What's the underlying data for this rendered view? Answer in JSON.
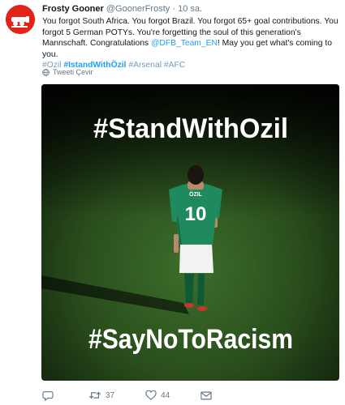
{
  "tweet": {
    "author_name": "Frosty Gooner",
    "author_handle": "@GoonerFrosty",
    "separator": "·",
    "time": "10 sa.",
    "text_part1": "You forgot South Africa. You forgot Brazil. You forgot 65+ goal contributions. You forgot 5 German POTYs. You're forgetting the soul of this generation's Mannschaft. Congratulations ",
    "mention": "@DFB_Team_EN",
    "text_part2": "! May you get what's coming to you.",
    "hashtags": [
      "#Ozil",
      "#IstandWithÖzil",
      "#Arsenal",
      "#AFC"
    ],
    "translate_label": "Tweeti Çevir",
    "image": {
      "top_text": "#StandWithOzil",
      "bottom_text": "#SayNoToRacism",
      "shirt_name": "ÖZIL",
      "shirt_number": "10"
    },
    "actions": {
      "reply_count": "",
      "retweet_count": "37",
      "like_count": "44"
    }
  },
  "colors": {
    "accent": "#1da1f2",
    "avatar_bg": "#e2231a",
    "pitch": "#2f5a22"
  },
  "icons": {
    "avatar": "arsenal-cannon-logo",
    "translate": "globe-icon",
    "reply": "reply-icon",
    "retweet": "retweet-icon",
    "like": "heart-icon",
    "dm": "envelope-icon"
  }
}
